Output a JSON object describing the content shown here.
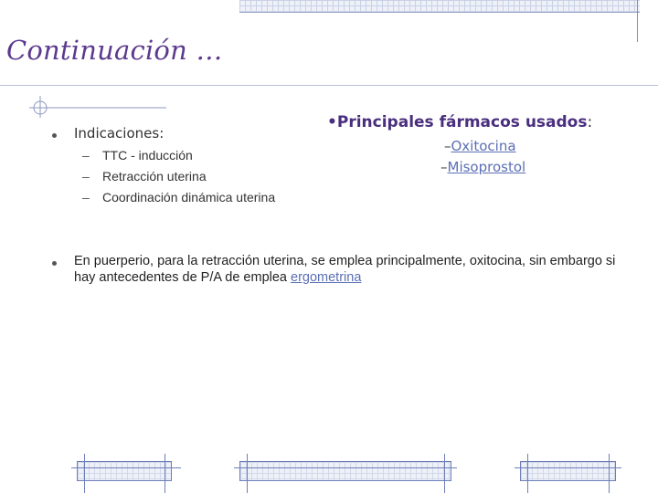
{
  "slide": {
    "title": "Continuación …",
    "left_list": {
      "heading": "Indicaciones:",
      "items": [
        "TTC - inducción",
        "Retracción uterina",
        "Coordinación dinámica uterina"
      ],
      "dash": "–"
    },
    "right_list": {
      "heading": "Principales fármacos usados",
      "heading_suffix": ":",
      "bullet": "•",
      "items": [
        "Oxitocina",
        "Misoprostol"
      ],
      "item_prefix": "–"
    },
    "paragraph": {
      "text": "En puerperio, para la retracción uterina, se emplea principalmente, oxitocina, sin embargo si hay antecedentes de P/A de emplea ",
      "link": "ergometrina"
    }
  }
}
